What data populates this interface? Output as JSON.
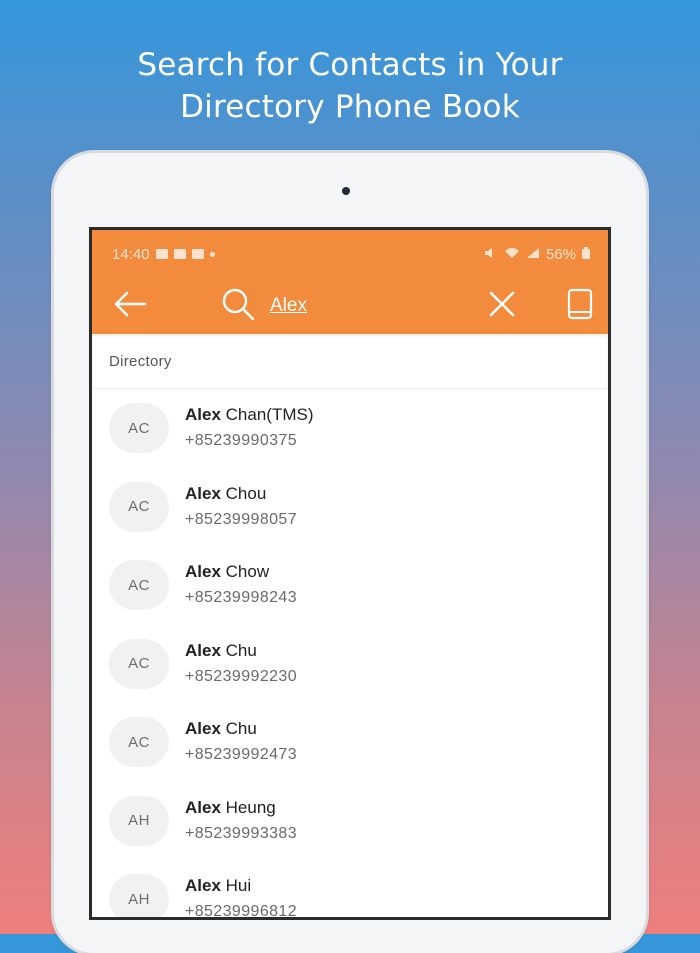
{
  "headline": {
    "line1": "Search for Contacts in Your",
    "line2": "Directory Phone Book"
  },
  "status_bar": {
    "time": "14:40",
    "battery": "56%"
  },
  "toolbar": {
    "back_icon": "arrow-left-icon",
    "search_icon": "search-icon",
    "search_value": "Alex",
    "clear_icon": "close-icon",
    "device_icon": "tablet-icon"
  },
  "section_title": "Directory",
  "contacts": [
    {
      "initials": "AC",
      "match": "Alex",
      "rest": " Chan(TMS)",
      "phone": "+85239990375"
    },
    {
      "initials": "AC",
      "match": "Alex",
      "rest": " Chou",
      "phone": "+85239998057"
    },
    {
      "initials": "AC",
      "match": "Alex",
      "rest": " Chow",
      "phone": "+85239998243"
    },
    {
      "initials": "AC",
      "match": "Alex",
      "rest": " Chu",
      "phone": "+85239992230"
    },
    {
      "initials": "AC",
      "match": "Alex",
      "rest": " Chu",
      "phone": "+85239992473"
    },
    {
      "initials": "AH",
      "match": "Alex",
      "rest": " Heung",
      "phone": "+85239993383"
    },
    {
      "initials": "AH",
      "match": "Alex",
      "rest": " Hui",
      "phone": "+85239996812"
    }
  ],
  "colors": {
    "accent": "#f38b3c"
  }
}
